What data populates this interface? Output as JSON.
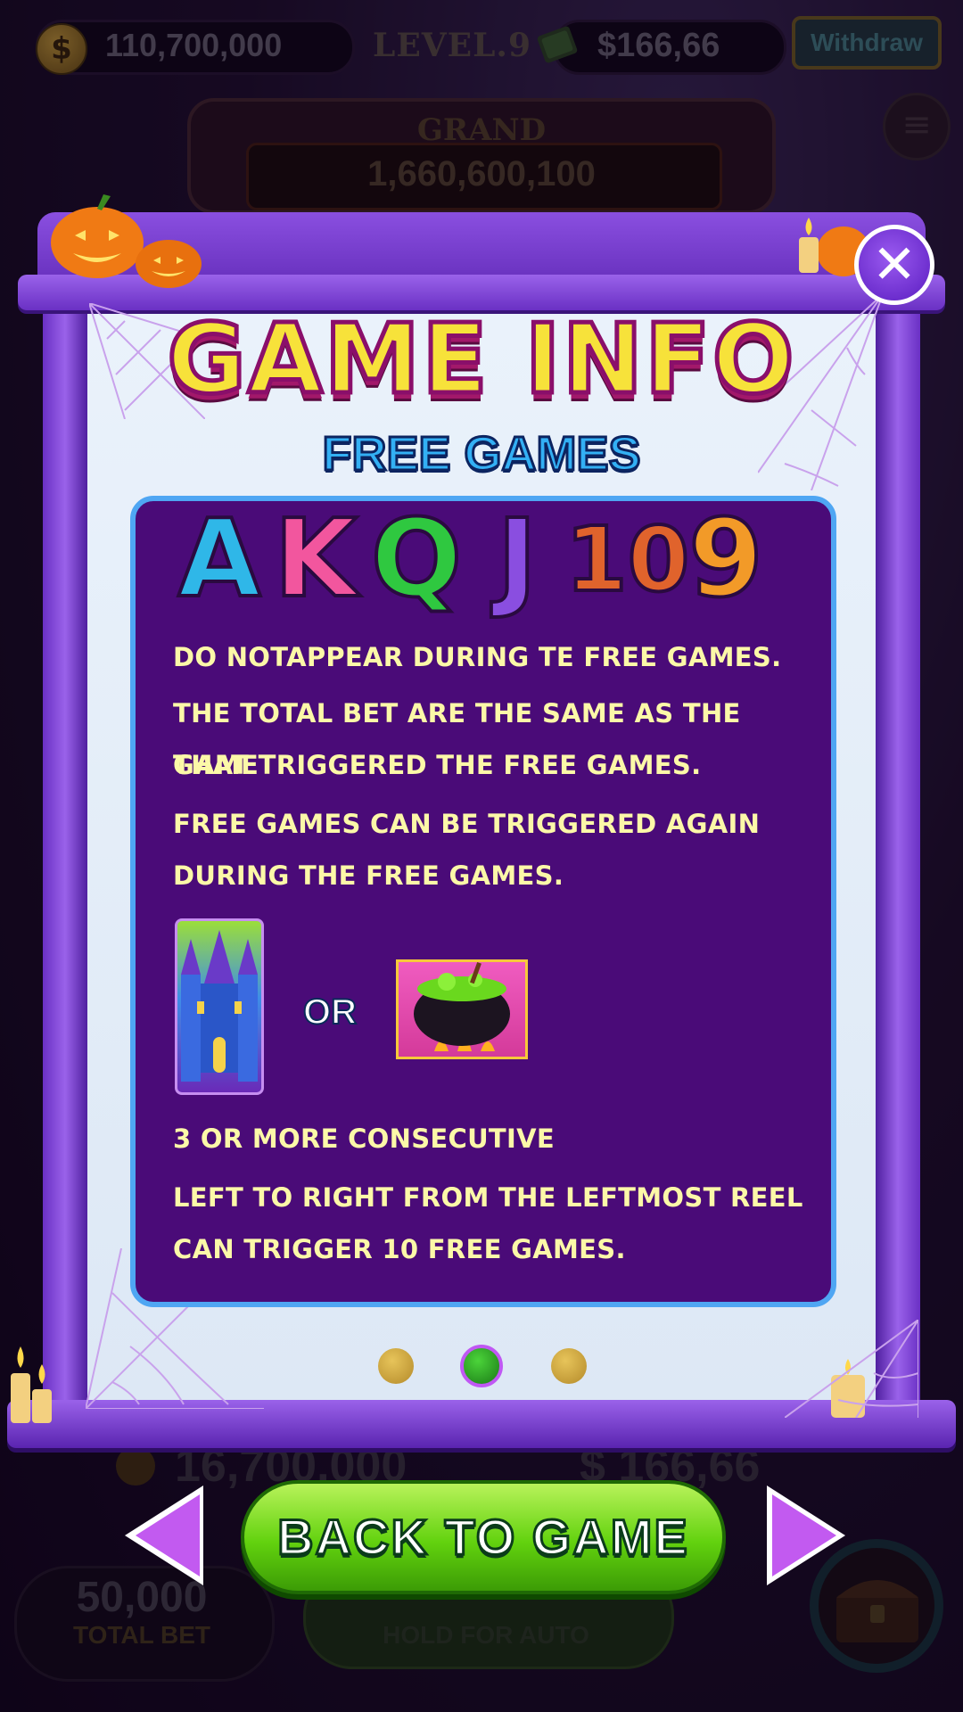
{
  "top_bar": {
    "coins": "110,700,000",
    "level": "LEVEL.9",
    "cash": "$166,66",
    "withdraw_label": "Withdraw"
  },
  "jackpot": {
    "label": "GRAND",
    "value": "1,660,600,100"
  },
  "panel": {
    "title": "GAME INFO",
    "subtitle": "FREE GAMES",
    "symbols": [
      "A",
      "K",
      "Q",
      "J",
      "10",
      "9"
    ],
    "symbol_colors": [
      "#2fb7e8",
      "#f2569e",
      "#2fc840",
      "#8a4ee0",
      "#e0632c",
      "#f29a28"
    ],
    "paragraphs": [
      [
        "DO NOTAPPEAR DURING TE FREE GAMES."
      ],
      [
        "THE TOTAL BET ARE THE SAME AS THE GAME",
        "THAT TRIGGERED THE FREE GAMES."
      ],
      [
        "FREE GAMES CAN BE TRIGGERED AGAIN",
        "DURING THE FREE GAMES."
      ]
    ],
    "or_label": "OR",
    "trigger_paragraphs": [
      [
        "3 OR MORE CONSECUTIVE"
      ],
      [
        "LEFT TO RIGHT FROM THE LEFTMOST REEL",
        "CAN TRIGGER 10 FREE GAMES."
      ]
    ],
    "page_indicator": {
      "current": 2,
      "total": 3
    },
    "close_icon": "close-icon"
  },
  "bottom_bar": {
    "coins": "16,700,000",
    "cash": "$ 166,66",
    "total_bet_value": "50,000",
    "total_bet_label": "TOTAL BET",
    "spin_hint": "HOLD FOR AUTO"
  },
  "navigation": {
    "back_label": "BACK TO GAME",
    "prev_icon": "arrow-left-icon",
    "next_icon": "arrow-right-icon"
  },
  "colors": {
    "title_fill": "#f7e23a",
    "subtitle_fill": "#33b0f4",
    "content_bg": "#4a0b78",
    "text": "#fcf8a8",
    "button_green": "#62d20e",
    "panel_purple": "#8a4fe0"
  }
}
